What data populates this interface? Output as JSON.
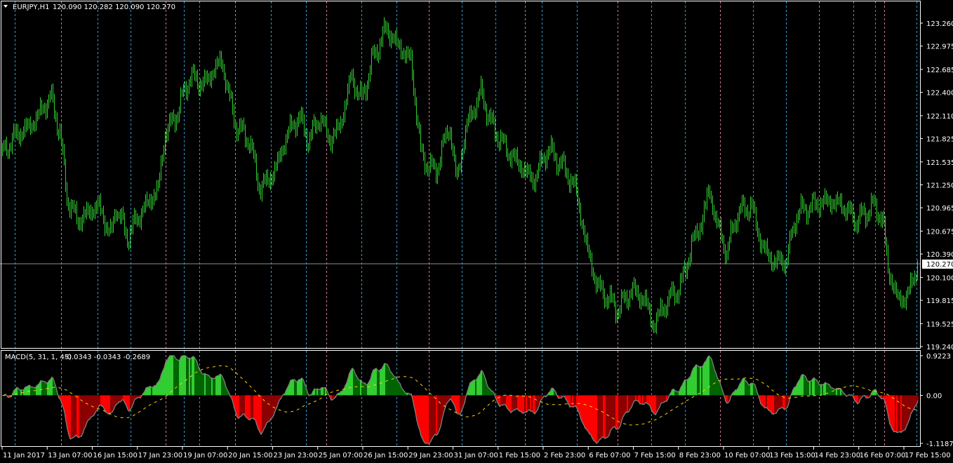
{
  "chart_data": [
    {
      "type": "bar",
      "subtype": "ohlc-bars",
      "title": "EURJPY,H1",
      "header_values": "120.090 120.282 120.090 120.270",
      "symbol": "EURJPY",
      "timeframe": "H1",
      "ohlc": {
        "open": 120.09,
        "high": 120.282,
        "low": 120.09,
        "close": 120.27
      },
      "current_price": "120.270",
      "ylim": [
        119.24,
        123.26
      ],
      "y_ticks": [
        "123.260",
        "122.975",
        "122.685",
        "122.400",
        "122.110",
        "121.825",
        "121.535",
        "121.250",
        "120.965",
        "120.675",
        "120.390",
        "120.100",
        "119.815",
        "119.525",
        "119.240"
      ],
      "bar_color": "#32cd32",
      "price_path_keypoints": [
        [
          0,
          121.6
        ],
        [
          20,
          121.85
        ],
        [
          45,
          122.0
        ],
        [
          72,
          122.35
        ],
        [
          85,
          121.9
        ],
        [
          95,
          121.1
        ],
        [
          110,
          120.8
        ],
        [
          140,
          121.0
        ],
        [
          158,
          120.6
        ],
        [
          165,
          121.0
        ],
        [
          180,
          120.6
        ],
        [
          200,
          120.9
        ],
        [
          225,
          121.2
        ],
        [
          235,
          121.9
        ],
        [
          250,
          122.1
        ],
        [
          270,
          122.6
        ],
        [
          290,
          122.5
        ],
        [
          315,
          122.8
        ],
        [
          335,
          122.0
        ],
        [
          355,
          121.8
        ],
        [
          370,
          121.2
        ],
        [
          390,
          121.4
        ],
        [
          410,
          121.9
        ],
        [
          425,
          122.1
        ],
        [
          440,
          121.8
        ],
        [
          455,
          122.1
        ],
        [
          470,
          121.8
        ],
        [
          485,
          122.0
        ],
        [
          500,
          122.6
        ],
        [
          515,
          122.3
        ],
        [
          530,
          122.8
        ],
        [
          550,
          123.2
        ],
        [
          565,
          123.0
        ],
        [
          585,
          122.8
        ],
        [
          600,
          121.6
        ],
        [
          620,
          121.4
        ],
        [
          640,
          122.0
        ],
        [
          650,
          121.3
        ],
        [
          665,
          122.0
        ],
        [
          685,
          122.4
        ],
        [
          700,
          122.0
        ],
        [
          720,
          121.7
        ],
        [
          740,
          121.5
        ],
        [
          760,
          121.3
        ],
        [
          780,
          121.7
        ],
        [
          800,
          121.5
        ],
        [
          820,
          121.2
        ],
        [
          835,
          120.5
        ],
        [
          850,
          120.0
        ],
        [
          870,
          119.8
        ],
        [
          880,
          119.7
        ],
        [
          900,
          119.95
        ],
        [
          920,
          119.8
        ],
        [
          930,
          119.5
        ],
        [
          950,
          119.8
        ],
        [
          970,
          120.0
        ],
        [
          985,
          120.5
        ],
        [
          1000,
          120.8
        ],
        [
          1010,
          121.2
        ],
        [
          1020,
          120.8
        ],
        [
          1035,
          120.4
        ],
        [
          1050,
          120.9
        ],
        [
          1070,
          121.0
        ],
        [
          1085,
          120.5
        ],
        [
          1100,
          120.3
        ],
        [
          1120,
          120.3
        ],
        [
          1135,
          120.9
        ],
        [
          1160,
          121.0
        ],
        [
          1180,
          121.05
        ],
        [
          1200,
          121.0
        ],
        [
          1220,
          120.8
        ],
        [
          1245,
          121.0
        ],
        [
          1258,
          120.8
        ],
        [
          1265,
          120.2
        ],
        [
          1280,
          119.8
        ],
        [
          1295,
          119.9
        ],
        [
          1306,
          120.27
        ]
      ]
    },
    {
      "type": "bar",
      "subtype": "macd-histogram",
      "title": "MACD(5, 31, 1, 45)",
      "header_values": "-0.0343 -0.0343 -0.2689",
      "params": {
        "fast": 5,
        "slow": 31,
        "macd_sma": 1,
        "signal": 45
      },
      "values": {
        "main": -0.0343,
        "macd": -0.0343,
        "signal": -0.2689
      },
      "ylim": [
        -1.1187,
        0.9223
      ],
      "y_ticks": [
        "0.9223",
        "0.00",
        "-1.1187"
      ],
      "colors": {
        "up_pos": "#32cd32",
        "down_pos": "#006400",
        "down_neg": "#ff0000",
        "up_neg": "#8b0000",
        "line": "#808080",
        "signal": "#ffd700"
      }
    }
  ],
  "x_ticks": [
    "11 Jan 2017",
    "13 Jan 07:00",
    "16 Jan 15:00",
    "17 Jan 23:00",
    "19 Jan 07:00",
    "20 Jan 15:00",
    "23 Jan 23:00",
    "25 Jan 07:00",
    "26 Jan 15:00",
    "29 Jan 23:00",
    "31 Jan 07:00",
    "1 Feb 15:00",
    "2 Feb 23:00",
    "6 Feb 07:00",
    "7 Feb 15:00",
    "8 Feb 23:00",
    "10 Feb 07:00",
    "13 Feb 15:00",
    "14 Feb 23:00",
    "16 Feb 07:00",
    "17 Feb 15:00"
  ],
  "grid_colors": {
    "a": "#3399cc",
    "b": "#cc7799"
  }
}
